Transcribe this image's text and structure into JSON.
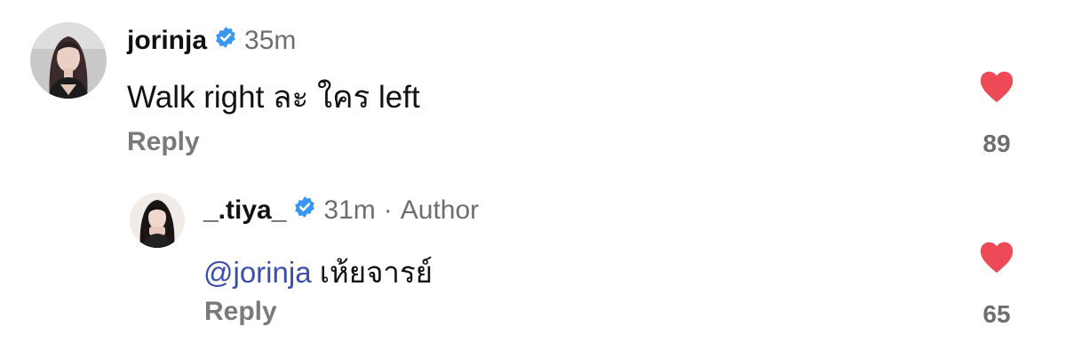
{
  "comments": [
    {
      "username": "jorinja",
      "verified": true,
      "time": "35m",
      "text": "Walk right ละ ใคร left",
      "reply_label": "Reply",
      "like_count": "89",
      "liked": true
    },
    {
      "username": "_.tiya_",
      "verified": true,
      "time": "31m",
      "separator": "·",
      "author_tag": "Author",
      "mention": "@jorinja",
      "text": "เห้ยจารย์",
      "reply_label": "Reply",
      "like_count": "65",
      "liked": true
    }
  ],
  "colors": {
    "verified_badge": "#3897f0",
    "heart": "#ed4956",
    "mention": "#3d4ea8",
    "secondary_text": "#6e6e6e"
  }
}
